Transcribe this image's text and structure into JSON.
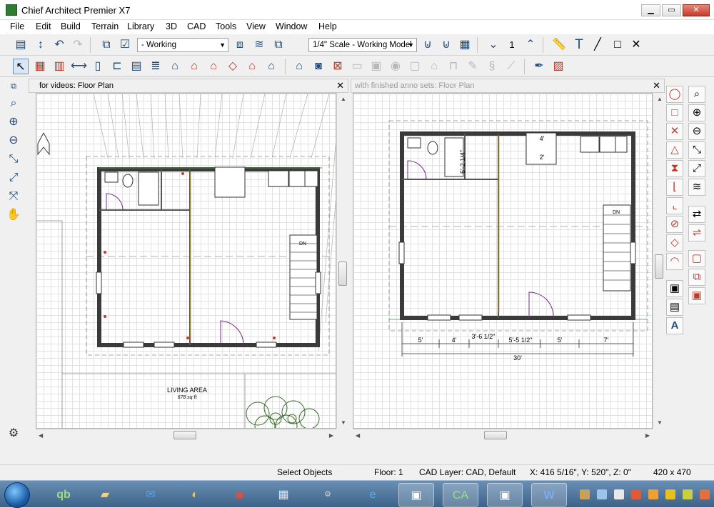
{
  "app": {
    "title": "Chief Architect Premier X7"
  },
  "window_controls": {
    "minimize": "▁",
    "maximize": "▭",
    "close": "✕"
  },
  "menu": [
    "File",
    "Edit",
    "Build",
    "Terrain",
    "Library",
    "3D",
    "CAD",
    "Tools",
    "View",
    "Window",
    "Help"
  ],
  "toolbar": {
    "layer_set": "- Working",
    "scale": "1/4\" Scale - Working Model",
    "floor_number": "1"
  },
  "views": {
    "left_title": "for videos: Floor Plan",
    "right_title": "with finished anno sets: Floor Plan",
    "close": "✕",
    "restore": "⧉"
  },
  "left_plan": {
    "room_label": "LIVING AREA",
    "room_area": "678 sq ft",
    "dn_label": "DN"
  },
  "right_plan": {
    "dn_label": "DN",
    "dim_top": "4'",
    "dim_closet": "2'",
    "dim_vertical": "6'-2 1/4\"",
    "dims_bottom": [
      "5'",
      "4'",
      "3'-6 1/2\"",
      "5'-5 1/2\"",
      "5'",
      "7'"
    ],
    "dim_total": "30'"
  },
  "status": {
    "mode": "Select Objects",
    "floor": "Floor: 1",
    "layer": "CAD Layer: CAD,  Default",
    "coords": "X: 416 5/16\", Y: 520\", Z: 0\"",
    "size": "420 x 470"
  },
  "taskbar": {
    "apps": [
      "qb",
      "folder",
      "outlook",
      "media",
      "chrome",
      "calculator",
      "steamworks",
      "ie",
      "screen",
      "chief-architect",
      "screen2",
      "word"
    ]
  },
  "colors": {
    "accent": "#244d7a",
    "wall": "#3a3a3a",
    "grid": "#e2e2e2",
    "taskbar": "#3d6289"
  }
}
